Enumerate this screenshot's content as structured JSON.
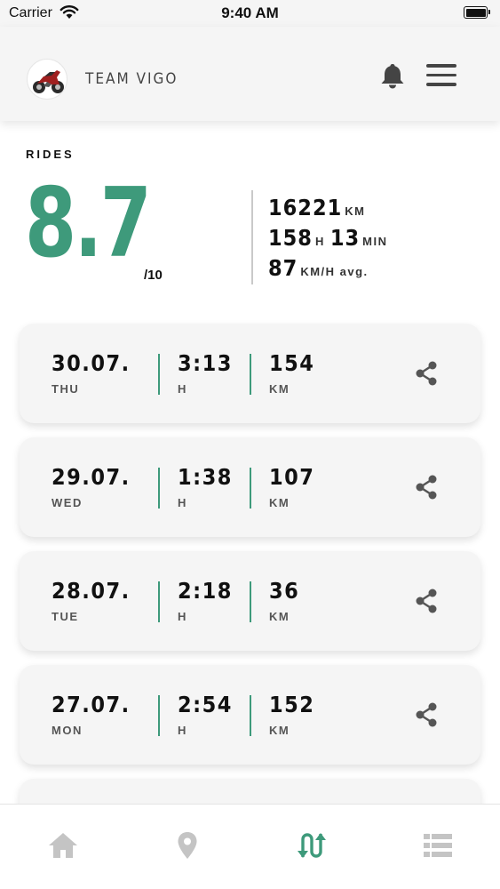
{
  "status_bar": {
    "carrier": "Carrier",
    "time": "9:40 AM"
  },
  "header": {
    "team_name": "TEAM VIGO",
    "avatar_icon": "motorcycle-avatar",
    "notification_icon": "bell-icon",
    "menu_icon": "hamburger-menu-icon"
  },
  "summary": {
    "section_label": "RIDES",
    "score": "8.7",
    "score_max": "/10",
    "distance_value": "16221",
    "distance_unit": "KM",
    "hours_value": "158",
    "hours_unit": "H",
    "minutes_value": "13",
    "minutes_unit": "MIN",
    "speed_value": "87",
    "speed_unit": "KM/H avg.",
    "accent_color": "#3e9a7b"
  },
  "rides": [
    {
      "date": "30.07.",
      "day": "THU",
      "time": "3:13",
      "time_unit": "H",
      "distance": "154",
      "distance_unit": "KM"
    },
    {
      "date": "29.07.",
      "day": "WED",
      "time": "1:38",
      "time_unit": "H",
      "distance": "107",
      "distance_unit": "KM"
    },
    {
      "date": "28.07.",
      "day": "TUE",
      "time": "2:18",
      "time_unit": "H",
      "distance": "36",
      "distance_unit": "KM"
    },
    {
      "date": "27.07.",
      "day": "MON",
      "time": "2:54",
      "time_unit": "H",
      "distance": "152",
      "distance_unit": "KM"
    }
  ],
  "tabbar": {
    "items": [
      {
        "icon": "home-icon",
        "active": false
      },
      {
        "icon": "map-pin-icon",
        "active": false
      },
      {
        "icon": "rides-route-icon",
        "active": true
      },
      {
        "icon": "list-icon",
        "active": false
      }
    ],
    "active_color": "#3e9a7b",
    "inactive_color": "#c4c4c4"
  }
}
